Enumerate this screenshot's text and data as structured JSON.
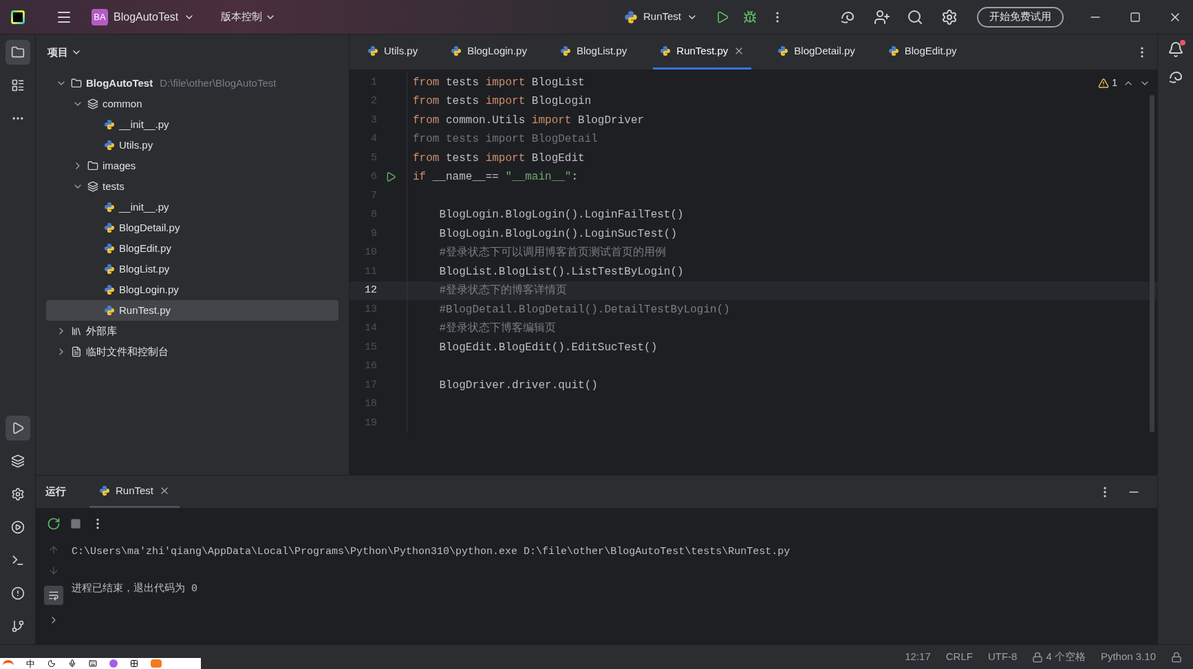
{
  "title_bar": {
    "project_badge": "BA",
    "project_name": "BlogAutoTest",
    "vcs": "版本控制",
    "run_config": "RunTest",
    "trial_button": "开始免费试用"
  },
  "project_panel": {
    "title": "项目",
    "tree": [
      {
        "label": "BlogAutoTest",
        "path": "D:\\file\\other\\BlogAutoTest",
        "kind": "root",
        "expanded": true,
        "selected": false,
        "children": [
          {
            "label": "common",
            "kind": "package",
            "expanded": true,
            "selected": false,
            "children": [
              {
                "label": "__init__.py",
                "kind": "pyfile",
                "selected": false
              },
              {
                "label": "Utils.py",
                "kind": "pyfile",
                "selected": false
              }
            ]
          },
          {
            "label": "images",
            "kind": "folder",
            "expanded": false,
            "selected": false
          },
          {
            "label": "tests",
            "kind": "package",
            "expanded": true,
            "selected": false,
            "children": [
              {
                "label": "__init__.py",
                "kind": "pyfile",
                "selected": false
              },
              {
                "label": "BlogDetail.py",
                "kind": "pyfile",
                "selected": false
              },
              {
                "label": "BlogEdit.py",
                "kind": "pyfile",
                "selected": false
              },
              {
                "label": "BlogList.py",
                "kind": "pyfile",
                "selected": false
              },
              {
                "label": "BlogLogin.py",
                "kind": "pyfile",
                "selected": false
              },
              {
                "label": "RunTest.py",
                "kind": "pyfile",
                "selected": true
              }
            ]
          }
        ]
      },
      {
        "label": "外部库",
        "kind": "library",
        "expanded": false,
        "selected": false
      },
      {
        "label": "临时文件和控制台",
        "kind": "scratch",
        "expanded": false,
        "selected": false
      }
    ]
  },
  "editor_tabs": [
    {
      "label": "Utils.py",
      "selected": false
    },
    {
      "label": "BlogLogin.py",
      "selected": false
    },
    {
      "label": "BlogList.py",
      "selected": false
    },
    {
      "label": "RunTest.py",
      "selected": true
    },
    {
      "label": "BlogDetail.py",
      "selected": false
    },
    {
      "label": "BlogEdit.py",
      "selected": false
    }
  ],
  "inspections": {
    "warnings": "1"
  },
  "code": [
    {
      "number": "1",
      "selected": false,
      "run_marker": false,
      "tokens": [
        {
          "text": "from ",
          "kind": "keyword"
        },
        {
          "text": "tests ",
          "kind": "plain"
        },
        {
          "text": "import ",
          "kind": "keyword"
        },
        {
          "text": "BlogList",
          "kind": "plain"
        }
      ]
    },
    {
      "number": "2",
      "selected": false,
      "run_marker": false,
      "tokens": [
        {
          "text": "from ",
          "kind": "keyword"
        },
        {
          "text": "tests ",
          "kind": "plain"
        },
        {
          "text": "import ",
          "kind": "keyword"
        },
        {
          "text": "BlogLogin",
          "kind": "plain"
        }
      ]
    },
    {
      "number": "3",
      "selected": false,
      "run_marker": false,
      "tokens": [
        {
          "text": "from ",
          "kind": "keyword"
        },
        {
          "text": "common.Utils ",
          "kind": "plain"
        },
        {
          "text": "import ",
          "kind": "keyword"
        },
        {
          "text": "BlogDriver",
          "kind": "plain"
        }
      ]
    },
    {
      "number": "4",
      "selected": false,
      "run_marker": false,
      "tokens": [
        {
          "text": "from tests import BlogDetail",
          "kind": "unused"
        }
      ]
    },
    {
      "number": "5",
      "selected": false,
      "run_marker": false,
      "tokens": [
        {
          "text": "from ",
          "kind": "keyword"
        },
        {
          "text": "tests ",
          "kind": "plain"
        },
        {
          "text": "import ",
          "kind": "keyword"
        },
        {
          "text": "BlogEdit",
          "kind": "plain"
        }
      ]
    },
    {
      "number": "6",
      "selected": false,
      "run_marker": true,
      "tokens": [
        {
          "text": "if ",
          "kind": "keyword"
        },
        {
          "text": "__name__== ",
          "kind": "plain"
        },
        {
          "text": "\"__main__\"",
          "kind": "string"
        },
        {
          "text": ":",
          "kind": "plain"
        }
      ]
    },
    {
      "number": "7",
      "selected": false,
      "run_marker": false
    },
    {
      "number": "8",
      "selected": false,
      "run_marker": false,
      "tokens": [
        {
          "text": "    BlogLogin.BlogLogin().LoginFailTest()",
          "kind": "plain"
        }
      ]
    },
    {
      "number": "9",
      "selected": false,
      "run_marker": false,
      "tokens": [
        {
          "text": "    BlogLogin.BlogLogin().LoginSucTest()",
          "kind": "plain"
        }
      ]
    },
    {
      "number": "10",
      "selected": false,
      "run_marker": false,
      "tokens": [
        {
          "text": "    #登录状态下可以调用博客首页测试首页的用例",
          "kind": "comment"
        }
      ]
    },
    {
      "number": "11",
      "selected": false,
      "run_marker": false,
      "tokens": [
        {
          "text": "    BlogList.BlogList().ListTestByLogin()",
          "kind": "plain"
        }
      ]
    },
    {
      "number": "12",
      "selected": true,
      "run_marker": false,
      "tokens": [
        {
          "text": "    #登录状态下的博客详情页",
          "kind": "comment"
        }
      ]
    },
    {
      "number": "13",
      "selected": false,
      "run_marker": false,
      "tokens": [
        {
          "text": "    #BlogDetail.BlogDetail().DetailTestByLogin()",
          "kind": "comment"
        }
      ]
    },
    {
      "number": "14",
      "selected": false,
      "run_marker": false,
      "tokens": [
        {
          "text": "    #登录状态下博客编辑页",
          "kind": "comment"
        }
      ]
    },
    {
      "number": "15",
      "selected": false,
      "run_marker": false,
      "tokens": [
        {
          "text": "    BlogEdit.BlogEdit().EditSucTest()",
          "kind": "plain"
        }
      ]
    },
    {
      "number": "16",
      "selected": false,
      "run_marker": false
    },
    {
      "number": "17",
      "selected": false,
      "run_marker": false,
      "tokens": [
        {
          "text": "    BlogDriver.driver.quit()",
          "kind": "plain"
        }
      ]
    },
    {
      "number": "18",
      "selected": false,
      "run_marker": false
    },
    {
      "number": "19",
      "selected": false,
      "run_marker": false
    }
  ],
  "run_panel": {
    "title": "运行",
    "tabs": [
      {
        "label": "RunTest",
        "selected": true
      }
    ],
    "console": [
      {
        "kind": "command",
        "text": "C:\\Users\\ma'zhi'qiang\\AppData\\Local\\Programs\\Python\\Python310\\python.exe D:\\file\\other\\BlogAutoTest\\tests\\RunTest.py"
      },
      {
        "kind": "result",
        "text": "进程已结束，退出代码为 0"
      }
    ]
  },
  "status_bar": {
    "position": "12:17",
    "line_separator": "CRLF",
    "encoding": "UTF-8",
    "indent": "4 个空格",
    "interpreter": "Python 3.10"
  },
  "ime_bar": {
    "mode": "中"
  }
}
